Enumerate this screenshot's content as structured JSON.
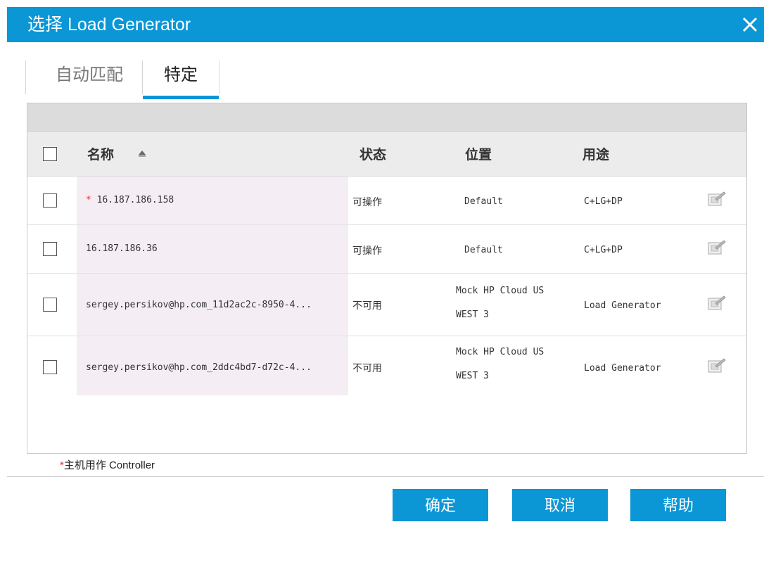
{
  "dialog": {
    "title": "选择 Load Generator",
    "close_icon": "close-icon"
  },
  "tabs": [
    {
      "label": "自动匹配",
      "active": false
    },
    {
      "label": "特定",
      "active": true
    }
  ],
  "table": {
    "headers": {
      "name": "名称",
      "status": "状态",
      "location": "位置",
      "purpose": "用途"
    },
    "sort": {
      "column": "name",
      "direction": "ascending"
    },
    "rows": [
      {
        "checked": false,
        "is_controller": true,
        "name": "16.187.186.158",
        "status": "可操作",
        "location": "Default",
        "location_line2": "",
        "purpose": "C+LG+DP"
      },
      {
        "checked": false,
        "is_controller": false,
        "name": "16.187.186.36",
        "status": "可操作",
        "location": "Default",
        "location_line2": "",
        "purpose": "C+LG+DP"
      },
      {
        "checked": false,
        "is_controller": false,
        "name": "sergey.persikov@hp.com_11d2ac2c-8950-4...",
        "status": "不可用",
        "location": "Mock HP Cloud US",
        "location_line2": "WEST 3",
        "purpose": "Load Generator"
      },
      {
        "checked": false,
        "is_controller": false,
        "name": "sergey.persikov@hp.com_2ddc4bd7-d72c-4...",
        "status": "不可用",
        "location": "Mock HP Cloud US",
        "location_line2": "WEST 3",
        "purpose": "Load Generator"
      }
    ]
  },
  "legend": {
    "star": "*",
    "text": "主机用作 Controller"
  },
  "buttons": {
    "ok": "确定",
    "cancel": "取消",
    "help": "帮助"
  },
  "colors": {
    "accent": "#0b96d6",
    "star": "#e03030"
  }
}
